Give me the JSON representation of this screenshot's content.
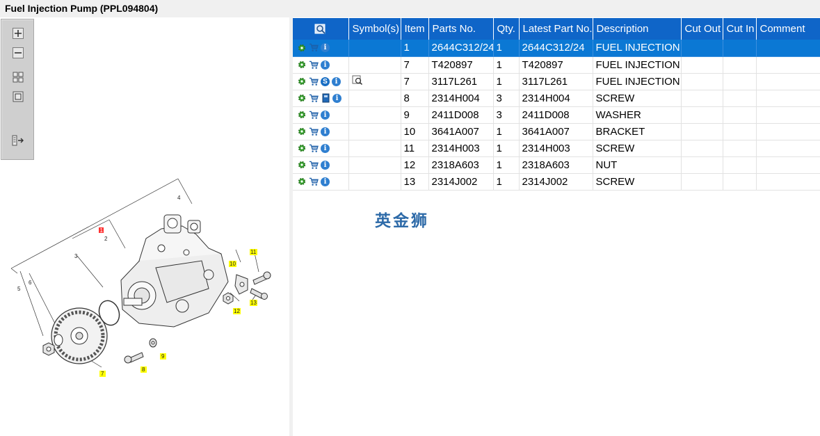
{
  "window": {
    "title": "Fuel Injection Pump (PPL094804)"
  },
  "toolbar": {
    "buttons": [
      {
        "name": "zoom-in-button",
        "icon": "zoom-in-icon"
      },
      {
        "name": "zoom-out-button",
        "icon": "zoom-out-icon"
      },
      {
        "name": "fit-all-button",
        "icon": "fit-all-icon"
      },
      {
        "name": "fit-window-button",
        "icon": "fit-window-icon"
      },
      {
        "name": "export-button",
        "icon": "export-icon"
      }
    ]
  },
  "diagram": {
    "callouts": [
      "1",
      "2",
      "3",
      "4",
      "5",
      "6",
      "7",
      "8",
      "9",
      "10",
      "11",
      "12",
      "13"
    ],
    "highlight_color": "#ffff00",
    "selected_callout_color": "#ff3030"
  },
  "grid": {
    "header_color": "#0f65c8",
    "selected_row_color": "#0b78d4",
    "columns": [
      "",
      "Symbol(s)",
      "Item",
      "Parts No.",
      "Qty.",
      "Latest Part No.",
      "Description",
      "Cut Out",
      "Cut In",
      "Comment"
    ],
    "rows": [
      {
        "icons": [
          "gear-icon",
          "cart-icon",
          "info-icon"
        ],
        "symbol": "",
        "item": "1",
        "part_no": "2644C312/24",
        "qty": "1",
        "latest": "2644C312/24",
        "description": "FUEL INJECTION PUMP",
        "cut_out": "",
        "cut_in": "",
        "comment": "",
        "selected": true
      },
      {
        "icons": [
          "gear-icon",
          "cart-icon",
          "info-icon"
        ],
        "symbol": "",
        "item": "7",
        "part_no": "T420897",
        "qty": "1",
        "latest": "T420897",
        "description": "FUEL INJECTION PUMP",
        "cut_out": "",
        "cut_in": "",
        "comment": ""
      },
      {
        "icons": [
          "gear-icon",
          "cart-icon",
          "s-icon",
          "info-icon"
        ],
        "symbol": "view",
        "item": "7",
        "part_no": "3117L261",
        "qty": "1",
        "latest": "3117L261",
        "description": "FUEL INJECTION PUMP",
        "cut_out": "",
        "cut_in": "",
        "comment": ""
      },
      {
        "icons": [
          "gear-icon",
          "cart-icon",
          "book-icon",
          "info-icon"
        ],
        "symbol": "",
        "item": "8",
        "part_no": "2314H004",
        "qty": "3",
        "latest": "2314H004",
        "description": "SCREW",
        "cut_out": "",
        "cut_in": "",
        "comment": ""
      },
      {
        "icons": [
          "gear-icon",
          "cart-icon",
          "info-icon"
        ],
        "symbol": "",
        "item": "9",
        "part_no": "2411D008",
        "qty": "3",
        "latest": "2411D008",
        "description": "WASHER",
        "cut_out": "",
        "cut_in": "",
        "comment": ""
      },
      {
        "icons": [
          "gear-icon",
          "cart-icon",
          "info-icon"
        ],
        "symbol": "",
        "item": "10",
        "part_no": "3641A007",
        "qty": "1",
        "latest": "3641A007",
        "description": "BRACKET",
        "cut_out": "",
        "cut_in": "",
        "comment": ""
      },
      {
        "icons": [
          "gear-icon",
          "cart-icon",
          "info-icon"
        ],
        "symbol": "",
        "item": "11",
        "part_no": "2314H003",
        "qty": "1",
        "latest": "2314H003",
        "description": "SCREW",
        "cut_out": "",
        "cut_in": "",
        "comment": ""
      },
      {
        "icons": [
          "gear-icon",
          "cart-icon",
          "info-icon"
        ],
        "symbol": "",
        "item": "12",
        "part_no": "2318A603",
        "qty": "1",
        "latest": "2318A603",
        "description": "NUT",
        "cut_out": "",
        "cut_in": "",
        "comment": ""
      },
      {
        "icons": [
          "gear-icon",
          "cart-icon",
          "info-icon"
        ],
        "symbol": "",
        "item": "13",
        "part_no": "2314J002",
        "qty": "1",
        "latest": "2314J002",
        "description": "SCREW",
        "cut_out": "",
        "cut_in": "",
        "comment": ""
      }
    ]
  },
  "watermark": "英金狮"
}
